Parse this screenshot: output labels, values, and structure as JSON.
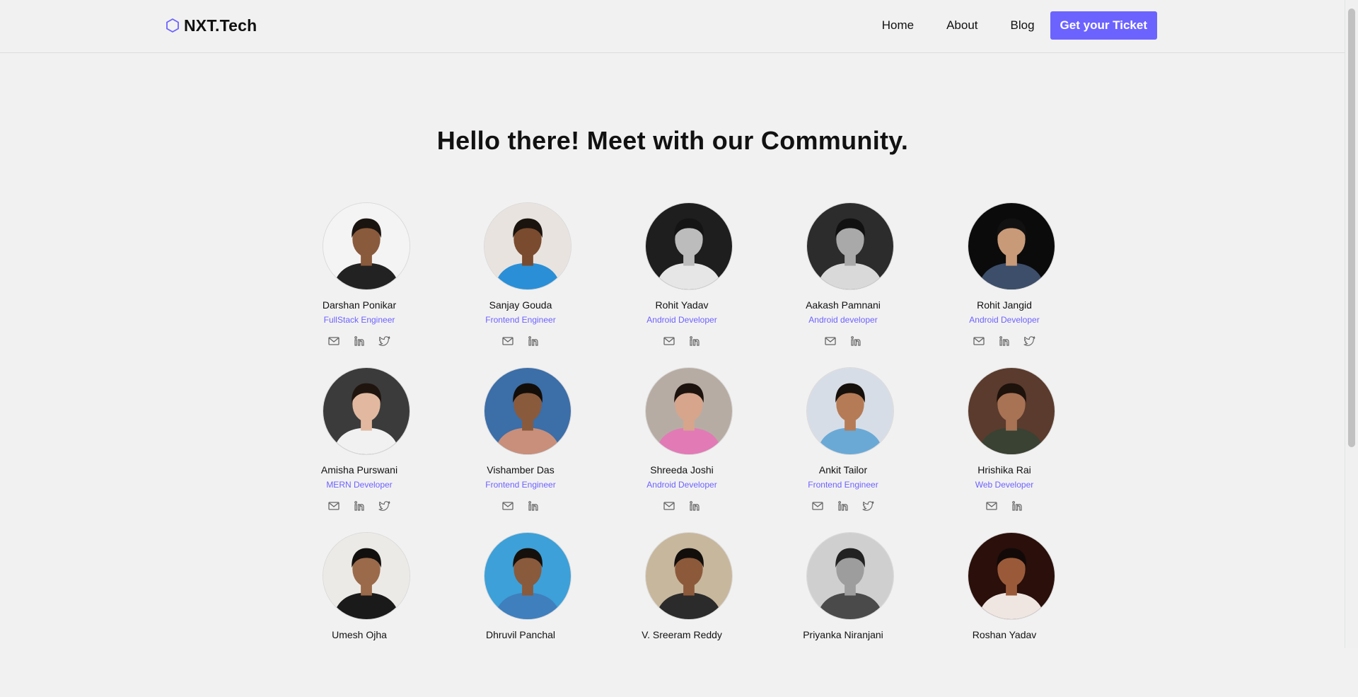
{
  "header": {
    "logo_text": "NXT.Tech",
    "nav": [
      {
        "label": "Home"
      },
      {
        "label": "About"
      },
      {
        "label": "Blog"
      }
    ],
    "cta_label": "Get your Ticket",
    "accent": "#6c63ff"
  },
  "main": {
    "title": "Hello there! Meet with our Community."
  },
  "members": [
    {
      "name": "Darshan Ponikar",
      "role": "FullStack Engineer",
      "socials": [
        "mail-icon",
        "linkedin-icon",
        "twitter-icon"
      ]
    },
    {
      "name": "Sanjay Gouda",
      "role": "Frontend Engineer",
      "socials": [
        "mail-icon",
        "linkedin-icon"
      ]
    },
    {
      "name": "Rohit Yadav",
      "role": "Android Developer",
      "socials": [
        "mail-icon",
        "linkedin-icon"
      ]
    },
    {
      "name": "Aakash Pamnani",
      "role": "Android developer",
      "socials": [
        "mail-icon",
        "linkedin-icon"
      ]
    },
    {
      "name": "Rohit Jangid",
      "role": "Android Developer",
      "socials": [
        "mail-icon",
        "linkedin-icon",
        "twitter-icon"
      ]
    },
    {
      "name": "Amisha Purswani",
      "role": "MERN Developer",
      "socials": [
        "mail-icon",
        "linkedin-icon",
        "twitter-icon"
      ]
    },
    {
      "name": "Vishamber Das",
      "role": "Frontend Engineer",
      "socials": [
        "mail-icon",
        "linkedin-icon"
      ]
    },
    {
      "name": "Shreeda Joshi",
      "role": "Android Developer",
      "socials": [
        "mail-icon",
        "linkedin-icon"
      ]
    },
    {
      "name": "Ankit Tailor",
      "role": "Frontend Engineer",
      "socials": [
        "mail-icon",
        "linkedin-icon",
        "twitter-icon"
      ]
    },
    {
      "name": "Hrishika Rai",
      "role": "Web Developer",
      "socials": [
        "mail-icon",
        "linkedin-icon"
      ]
    },
    {
      "name": "Umesh Ojha",
      "role": "",
      "socials": []
    },
    {
      "name": "Dhruvil Panchal",
      "role": "",
      "socials": []
    },
    {
      "name": "V. Sreeram Reddy",
      "role": "",
      "socials": []
    },
    {
      "name": "Priyanka Niranjani",
      "role": "",
      "socials": []
    },
    {
      "name": "Roshan Yadav",
      "role": "",
      "socials": []
    }
  ],
  "avatar_palettes": [
    {
      "bg": "#f4f4f4",
      "skin": "#8a5a3c",
      "hair": "#1a1410",
      "shirt": "#222"
    },
    {
      "bg": "#e8e3df",
      "skin": "#7a4b2e",
      "hair": "#1b130e",
      "shirt": "#2a8fd6"
    },
    {
      "bg": "#1e1e1e",
      "skin": "#bcbcbc",
      "hair": "#141414",
      "shirt": "#e6e6e6"
    },
    {
      "bg": "#2c2c2c",
      "skin": "#a9a9a9",
      "hair": "#111111",
      "shirt": "#d9d9d9"
    },
    {
      "bg": "#0b0b0b",
      "skin": "#c89a78",
      "hair": "#111",
      "shirt": "#3c4e6a"
    },
    {
      "bg": "#3b3b3b",
      "skin": "#e2b9a0",
      "hair": "#20140f",
      "shirt": "#f1f1f1"
    },
    {
      "bg": "#3c6ea8",
      "skin": "#8a5a3c",
      "hair": "#130d09",
      "shirt": "#c98f7a"
    },
    {
      "bg": "#b7aca3",
      "skin": "#d6a58c",
      "hair": "#1d130e",
      "shirt": "#e27ab6"
    },
    {
      "bg": "#d7dde6",
      "skin": "#b57b56",
      "hair": "#15100c",
      "shirt": "#6aa9d6"
    },
    {
      "bg": "#5a3b2d",
      "skin": "#a87254",
      "hair": "#1d120c",
      "shirt": "#394233"
    },
    {
      "bg": "#eceae6",
      "skin": "#9a6a4a",
      "hair": "#12100e",
      "shirt": "#1a1a1a"
    },
    {
      "bg": "#3da0d8",
      "skin": "#8a5a3c",
      "hair": "#16100c",
      "shirt": "#3f7fbd"
    },
    {
      "bg": "#c7b79d",
      "skin": "#8c5a3b",
      "hair": "#120e0c",
      "shirt": "#2b2b2b"
    },
    {
      "bg": "#cfcfcf",
      "skin": "#9d9d9d",
      "hair": "#222222",
      "shirt": "#4a4a4a"
    },
    {
      "bg": "#2a0f0b",
      "skin": "#9a5a3a",
      "hair": "#120a08",
      "shirt": "#efe6e2"
    }
  ]
}
